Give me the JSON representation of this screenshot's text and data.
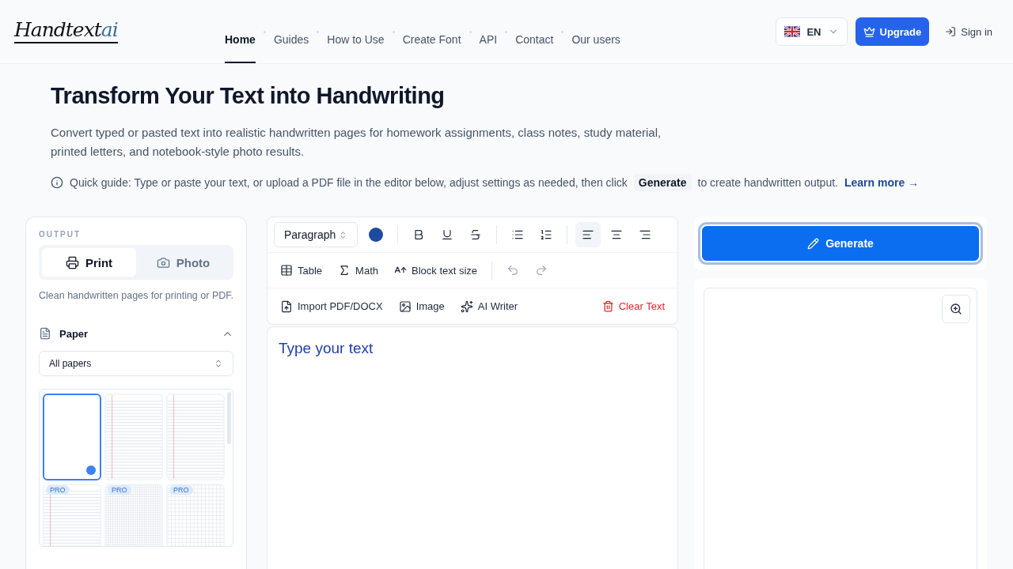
{
  "logo": {
    "name": "Handtext",
    "suffix": "ai"
  },
  "nav": [
    {
      "label": "Home",
      "selected": true
    },
    {
      "label": "Guides",
      "selected": false
    },
    {
      "label": "How to Use",
      "selected": false
    },
    {
      "label": "Create Font",
      "selected": false
    },
    {
      "label": "API",
      "selected": false
    },
    {
      "label": "Contact",
      "selected": false
    },
    {
      "label": "Our users",
      "selected": false
    }
  ],
  "language": {
    "code": "EN"
  },
  "upgrade_button": "Upgrade",
  "sign_in": "Sign in",
  "hero": {
    "title": "Transform Your Text into Handwriting",
    "description": "Convert typed or pasted text into realistic handwritten pages for homework assignments, class notes, study material, printed letters, and notebook-style photo results.",
    "guide_before": "Quick guide: Type or paste your text, or upload a PDF file in the editor below, adjust settings as needed, then click",
    "guide_key": "Generate",
    "guide_after": "to create handwritten output.",
    "learn_more": "Learn more →"
  },
  "output": {
    "heading": "OUTPUT",
    "modes": [
      {
        "kind": "print",
        "label": "Print",
        "selected": true
      },
      {
        "kind": "photo",
        "label": "Photo",
        "selected": false
      }
    ],
    "description": "Clean handwritten pages for printing or PDF."
  },
  "paper": {
    "title": "Paper",
    "expanded": true,
    "filter": "All papers",
    "papers": [
      {
        "kind": "blank",
        "selected": true
      },
      {
        "kind": "ruled",
        "selected": false
      },
      {
        "kind": "ruled",
        "selected": false
      },
      {
        "kind": "ruled",
        "selected": false,
        "badge": "PRO"
      },
      {
        "kind": "fine-grid",
        "selected": false,
        "badge": "PRO"
      },
      {
        "kind": "grid",
        "selected": false,
        "badge": "PRO"
      }
    ]
  },
  "toolbar": {
    "format_select": "Paragraph",
    "text_color": {
      "color": "#1e4aa0"
    },
    "format_buttons": [
      {
        "kind": "bold"
      },
      {
        "kind": "underline"
      },
      {
        "kind": "strike"
      }
    ],
    "list_buttons": [
      {
        "kind": "bullets"
      },
      {
        "kind": "numbers"
      }
    ],
    "align_buttons": [
      {
        "kind": "left",
        "selected": true
      },
      {
        "kind": "center",
        "selected": false
      },
      {
        "kind": "right",
        "selected": false
      }
    ],
    "insert_buttons": [
      {
        "kind": "table",
        "label": "Table"
      },
      {
        "kind": "math",
        "label": "Math"
      },
      {
        "kind": "size",
        "label": "Block text size"
      }
    ],
    "history_buttons": [
      {
        "kind": "undo"
      },
      {
        "kind": "redo"
      }
    ],
    "actions": [
      {
        "kind": "import",
        "label": "Import PDF/DOCX"
      },
      {
        "kind": "image",
        "label": "Image"
      },
      {
        "kind": "ai",
        "label": "AI Writer"
      }
    ],
    "clear_button": "Clear Text"
  },
  "editor": {
    "placeholder": "Type your text"
  },
  "generate_button": "Generate"
}
